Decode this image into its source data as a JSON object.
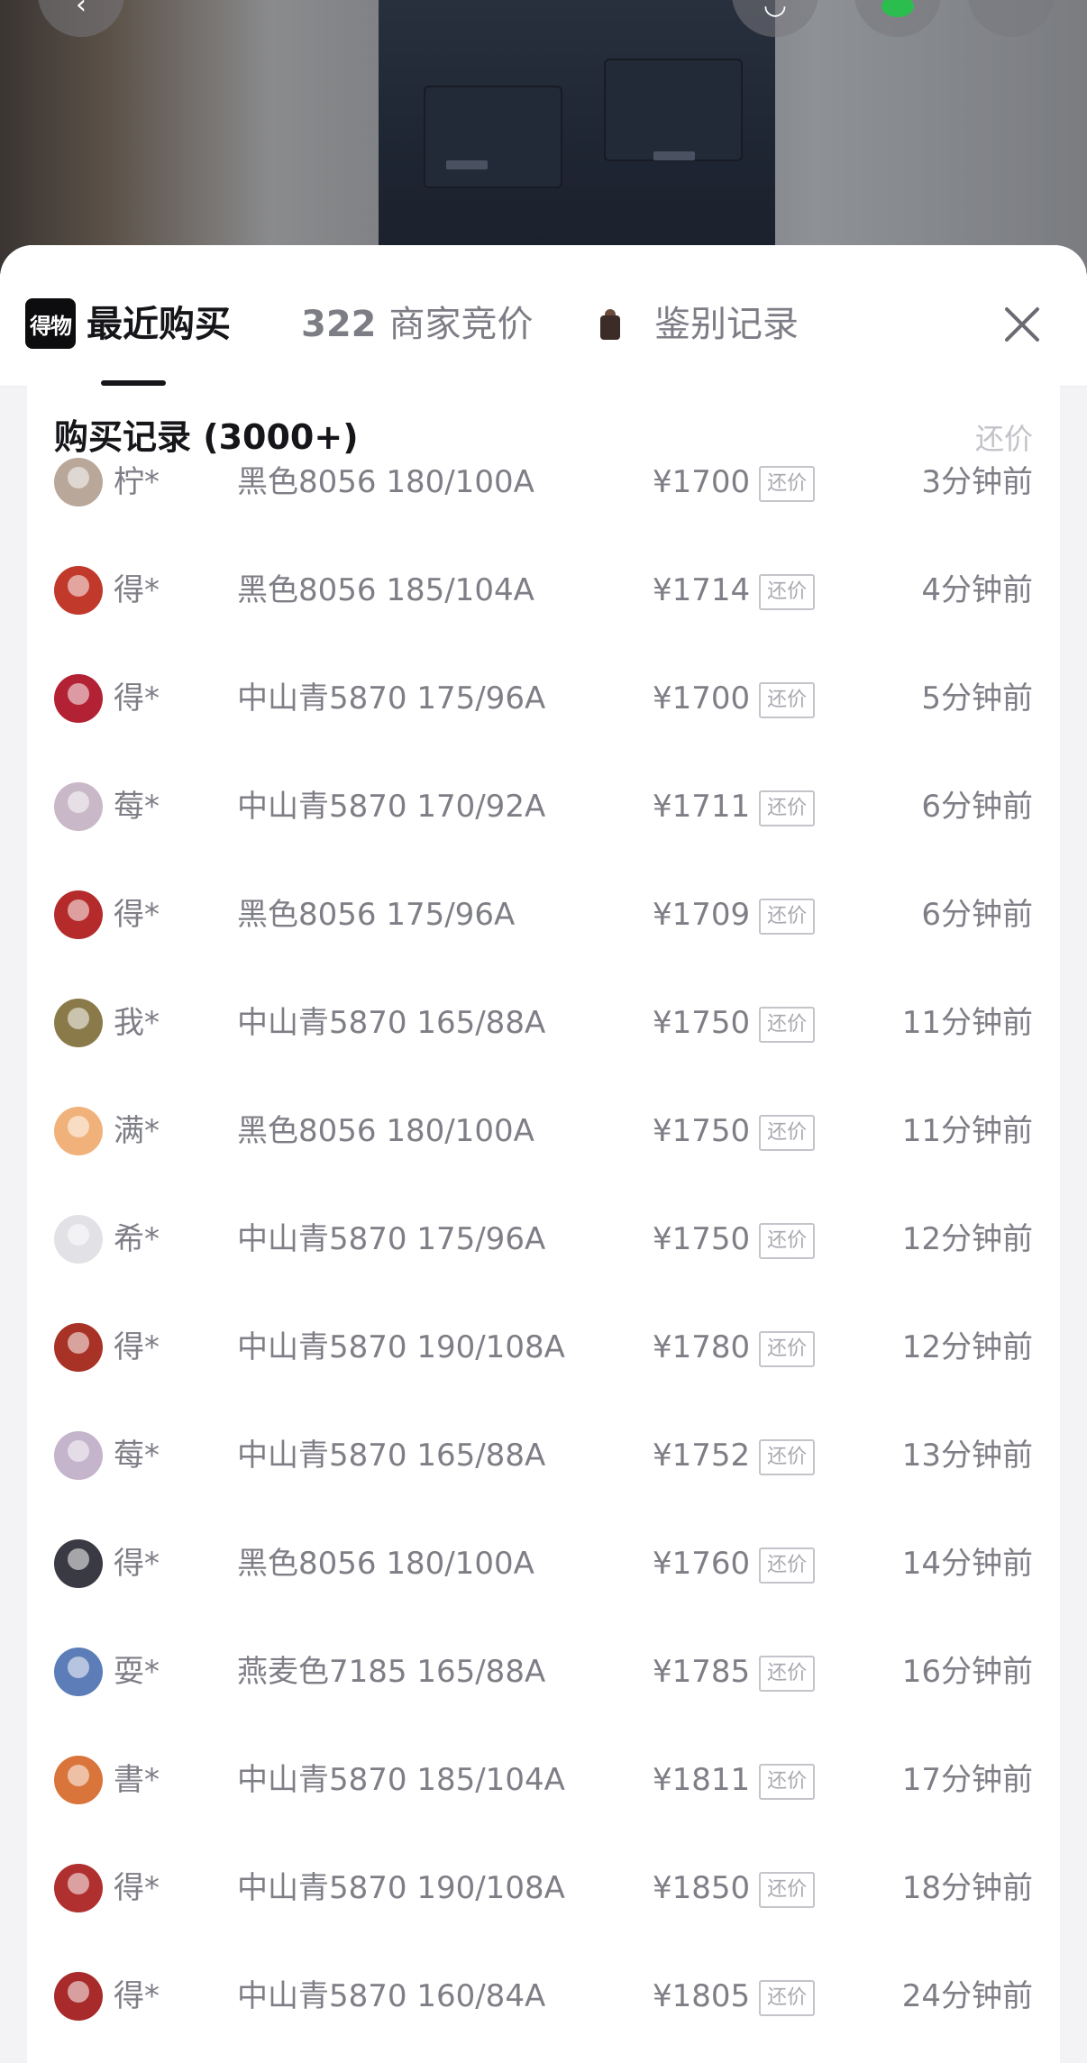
{
  "header": {
    "logo_text": "得物",
    "tab_recent": "最近购买",
    "tab_bid_count": "322",
    "tab_bid_label": "商家竞价",
    "tab_auth": "鉴别记录"
  },
  "records": {
    "title": "购买记录 (3000+)",
    "corner_action": "还价",
    "tag_label": "还价",
    "items": [
      {
        "user": "柠*",
        "spec": "黑色8056 180/100A",
        "price": "¥1700",
        "time": "3分钟前",
        "avatar_color": "#b9a79a"
      },
      {
        "user": "得*",
        "spec": "黑色8056 185/104A",
        "price": "¥1714",
        "time": "4分钟前",
        "avatar_color": "#c0392b"
      },
      {
        "user": "得*",
        "spec": "中山青5870 175/96A",
        "price": "¥1700",
        "time": "5分钟前",
        "avatar_color": "#b22234"
      },
      {
        "user": "莓*",
        "spec": "中山青5870 170/92A",
        "price": "¥1711",
        "time": "6分钟前",
        "avatar_color": "#c9b8c8"
      },
      {
        "user": "得*",
        "spec": "黑色8056 175/96A",
        "price": "¥1709",
        "time": "6分钟前",
        "avatar_color": "#b52a2a"
      },
      {
        "user": "我*",
        "spec": "中山青5870 165/88A",
        "price": "¥1750",
        "time": "11分钟前",
        "avatar_color": "#8a7a4a"
      },
      {
        "user": "满*",
        "spec": "黑色8056 180/100A",
        "price": "¥1750",
        "time": "11分钟前",
        "avatar_color": "#f0b27a"
      },
      {
        "user": "希*",
        "spec": "中山青5870 175/96A",
        "price": "¥1750",
        "time": "12分钟前",
        "avatar_color": "#e2e2e6"
      },
      {
        "user": "得*",
        "spec": "中山青5870 190/108A",
        "price": "¥1780",
        "time": "12分钟前",
        "avatar_color": "#a93226"
      },
      {
        "user": "莓*",
        "spec": "中山青5870 165/88A",
        "price": "¥1752",
        "time": "13分钟前",
        "avatar_color": "#c4b4cc"
      },
      {
        "user": "得*",
        "spec": "黑色8056 180/100A",
        "price": "¥1760",
        "time": "14分钟前",
        "avatar_color": "#3a3a44"
      },
      {
        "user": "耍*",
        "spec": "燕麦色7185 165/88A",
        "price": "¥1785",
        "time": "16分钟前",
        "avatar_color": "#5d7db8"
      },
      {
        "user": "書*",
        "spec": "中山青5870 185/104A",
        "price": "¥1811",
        "time": "17分钟前",
        "avatar_color": "#d9743a"
      },
      {
        "user": "得*",
        "spec": "中山青5870 190/108A",
        "price": "¥1850",
        "time": "18分钟前",
        "avatar_color": "#b03030"
      },
      {
        "user": "得*",
        "spec": "中山青5870 160/84A",
        "price": "¥1805",
        "time": "24分钟前",
        "avatar_color": "#a82a2a"
      }
    ]
  }
}
